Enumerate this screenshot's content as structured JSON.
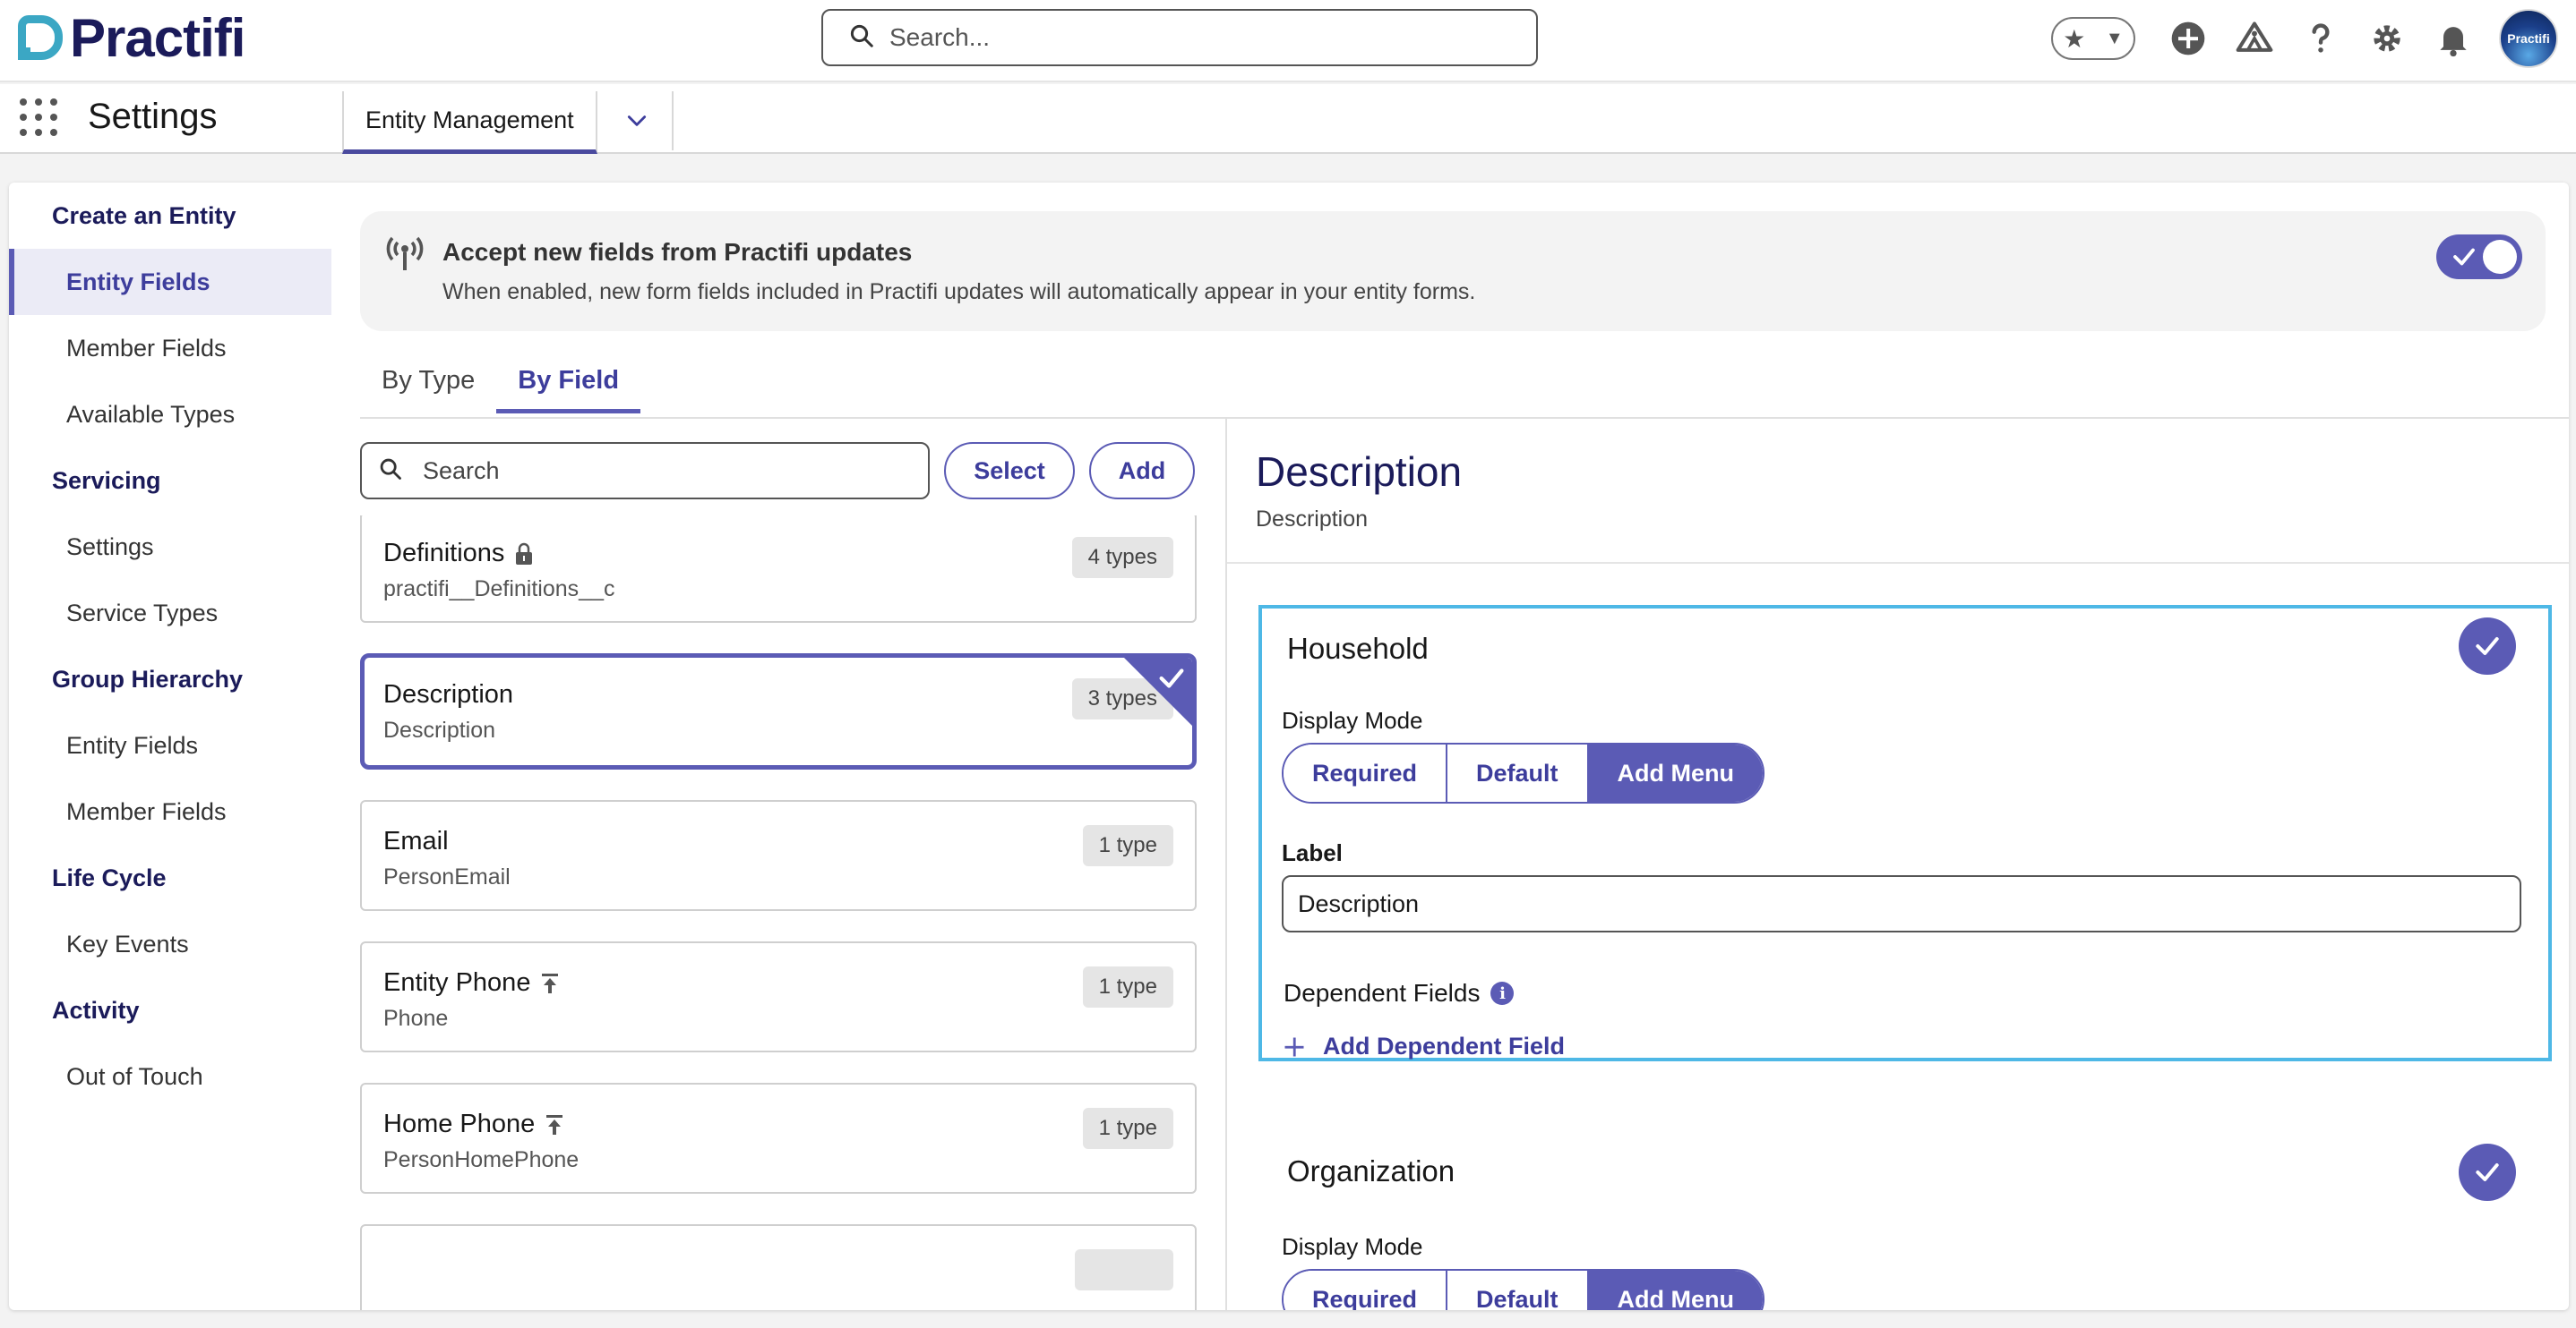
{
  "header": {
    "logo_text": "Practifi",
    "search_placeholder": "Search...",
    "avatar_text": "Practifi",
    "icons": [
      "star-icon",
      "chevron-down-icon",
      "plus-circle-icon",
      "trailhead-icon",
      "help-icon",
      "gear-icon",
      "bell-icon"
    ]
  },
  "nav": {
    "app_name": "Settings",
    "tab_label": "Entity Management"
  },
  "sidebar": {
    "groups": [
      {
        "label": "Create an Entity",
        "items": [
          {
            "label": "Entity Fields",
            "active": true
          },
          {
            "label": "Member Fields"
          },
          {
            "label": "Available Types"
          }
        ]
      },
      {
        "label": "Servicing",
        "items": [
          {
            "label": "Settings"
          },
          {
            "label": "Service Types"
          }
        ]
      },
      {
        "label": "Group Hierarchy",
        "items": [
          {
            "label": "Entity Fields"
          },
          {
            "label": "Member Fields"
          }
        ]
      },
      {
        "label": "Life Cycle",
        "items": [
          {
            "label": "Key Events"
          }
        ]
      },
      {
        "label": "Activity",
        "items": [
          {
            "label": "Out of Touch"
          }
        ]
      }
    ]
  },
  "banner": {
    "title": "Accept new fields from Practifi updates",
    "description": "When enabled, new form fields included in Practifi updates will automatically appear in your entity forms.",
    "toggle_on": true
  },
  "tabs": [
    {
      "label": "By Type",
      "active": false
    },
    {
      "label": "By Field",
      "active": true
    }
  ],
  "field_list": {
    "search_placeholder": "Search",
    "select_label": "Select",
    "add_label": "Add",
    "items": [
      {
        "name": "Definitions",
        "api": "practifi__Definitions__c",
        "badge": "4 types",
        "icon": "lock-icon"
      },
      {
        "name": "Description",
        "api": "Description",
        "badge": "3 types",
        "selected": true
      },
      {
        "name": "Email",
        "api": "PersonEmail",
        "badge": "1 type"
      },
      {
        "name": "Entity Phone",
        "api": "Phone",
        "badge": "1 type",
        "icon": "promote-icon"
      },
      {
        "name": "Home Phone",
        "api": "PersonHomePhone",
        "badge": "1 type",
        "icon": "promote-icon"
      }
    ]
  },
  "detail": {
    "title": "Description",
    "subtitle": "Description",
    "cards": [
      {
        "title": "Household",
        "display_mode_label": "Display Mode",
        "modes": [
          "Required",
          "Default",
          "Add Menu"
        ],
        "active_mode": "Add Menu",
        "label_caption": "Label",
        "label_value": "Description",
        "dependent_label": "Dependent Fields",
        "add_dependent_label": "Add Dependent Field"
      },
      {
        "title": "Organization",
        "display_mode_label": "Display Mode",
        "modes": [
          "Required",
          "Default",
          "Add Menu"
        ],
        "active_mode": "Add Menu"
      }
    ]
  },
  "colors": {
    "accent": "#5b5bb5",
    "focus": "#4eb8e6",
    "brand": "#3ba7c4",
    "brand_dark": "#1b1b5a"
  }
}
